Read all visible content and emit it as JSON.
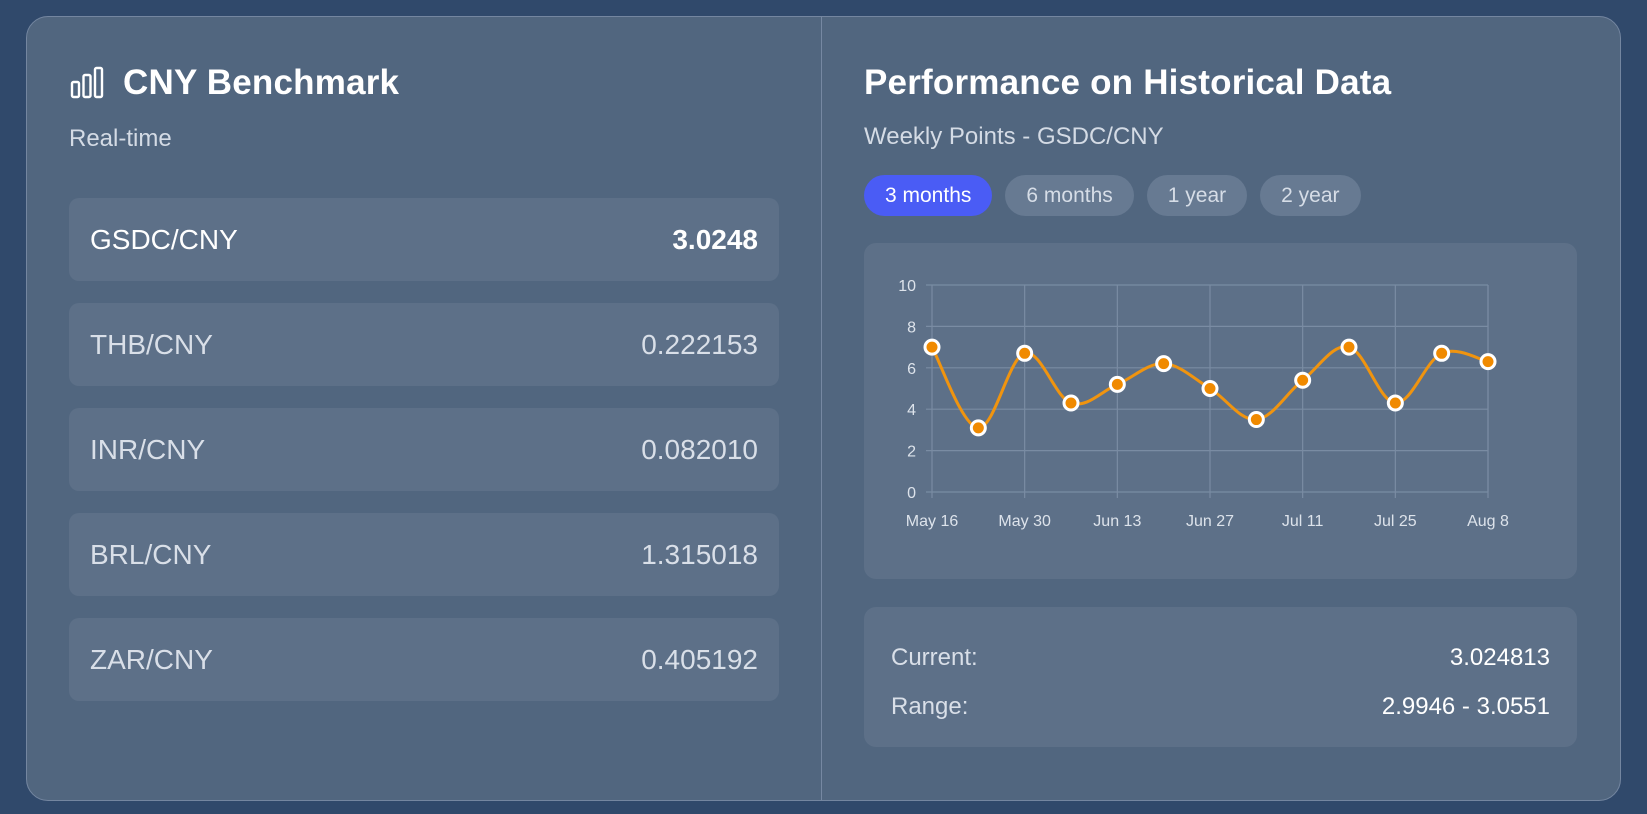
{
  "benchmark": {
    "title": "CNY Benchmark",
    "icon": "bar-chart-icon",
    "subtitle": "Real-time",
    "rates": [
      {
        "pair": "GSDC/CNY",
        "value": "3.0248"
      },
      {
        "pair": "THB/CNY",
        "value": "0.222153"
      },
      {
        "pair": "INR/CNY",
        "value": "0.082010"
      },
      {
        "pair": "BRL/CNY",
        "value": "1.315018"
      },
      {
        "pair": "ZAR/CNY",
        "value": "0.405192"
      }
    ]
  },
  "performance": {
    "title": "Performance on Historical Data",
    "subtitle": "Weekly Points - GSDC/CNY",
    "ranges": [
      {
        "label": "3 months",
        "active": true
      },
      {
        "label": "6 months",
        "active": false
      },
      {
        "label": "1 year",
        "active": false
      },
      {
        "label": "2 year",
        "active": false
      }
    ],
    "current_label": "Current:",
    "current_value": "3.024813",
    "range_label": "Range:",
    "range_value": "2.9946 - 3.0551"
  },
  "colors": {
    "accent": "#4a5cf5",
    "line": "#f0940f",
    "point": "#f08a00"
  },
  "chart_data": {
    "type": "line",
    "x": [
      "May 16",
      "May 23",
      "May 30",
      "Jun 6",
      "Jun 13",
      "Jun 20",
      "Jun 27",
      "Jul 4",
      "Jul 11",
      "Jul 18",
      "Jul 25",
      "Aug 1",
      "Aug 8"
    ],
    "values": [
      7.0,
      3.1,
      6.7,
      4.3,
      5.2,
      6.2,
      5.0,
      3.5,
      5.4,
      7.0,
      4.3,
      6.7,
      6.3
    ],
    "xticks": [
      "May 16",
      "May 30",
      "Jun 13",
      "Jun 27",
      "Jul 11",
      "Jul 25",
      "Aug 8"
    ],
    "yticks": [
      "0",
      "2",
      "4",
      "6",
      "8",
      "10"
    ],
    "ylim": [
      0,
      10
    ],
    "grid": true,
    "title": "",
    "xlabel": "",
    "ylabel": ""
  }
}
